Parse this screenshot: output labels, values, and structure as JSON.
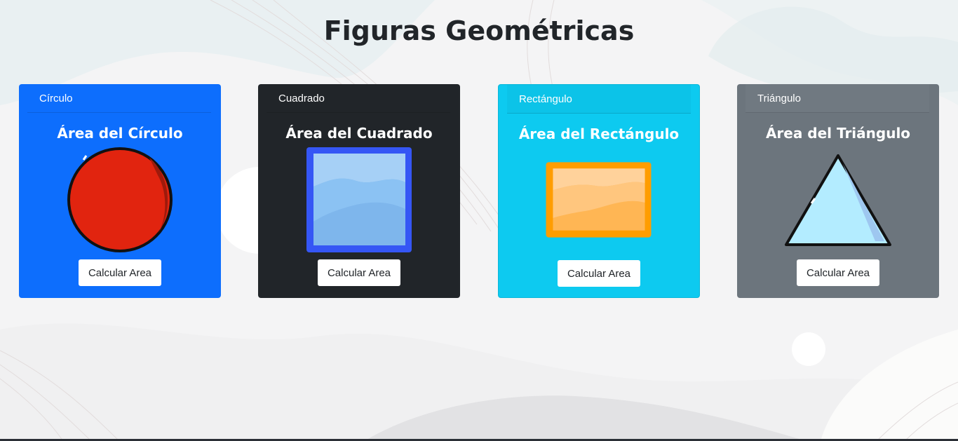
{
  "page": {
    "title": "Figuras Geométricas"
  },
  "cards": [
    {
      "header": "Círculo",
      "title": "Área del Círculo",
      "shape_icon": "red-circle-icon",
      "button_label": "Calcular Area",
      "color": "#0d6efd"
    },
    {
      "header": "Cuadrado",
      "title": "Área del Cuadrado",
      "shape_icon": "blue-square-icon",
      "button_label": "Calcular Area",
      "color": "#212529"
    },
    {
      "header": "Rectángulo",
      "title": "Área del Rectángulo",
      "shape_icon": "orange-rectangle-icon",
      "button_label": "Calcular Area",
      "color": "#0dcaf0"
    },
    {
      "header": "Triángulo",
      "title": "Área del Triángulo",
      "shape_icon": "blue-triangle-icon",
      "button_label": "Calcular Area",
      "color": "#6c757d"
    }
  ]
}
